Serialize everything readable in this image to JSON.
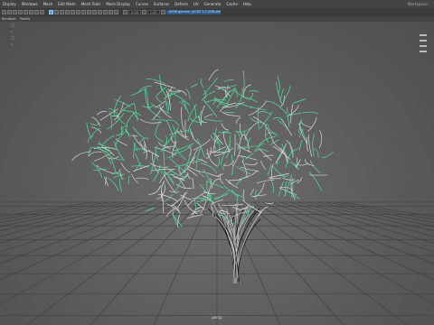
{
  "menubar": {
    "items": [
      "Display",
      "Windows",
      "Mesh",
      "Edit Mesh",
      "Mesh Tools",
      "Mesh Display",
      "Curves",
      "Surfaces",
      "Deform",
      "UV",
      "Generate",
      "Cache",
      "Help"
    ],
    "workspace": "Workspace:"
  },
  "toolbar": {
    "value1": "0.00",
    "value2": "1.00",
    "color_space": "sRGB gamma (ACES 1.0 SDR-video)"
  },
  "panel_menu": [
    "Renderer",
    "Panels"
  ],
  "left_icons": [
    "□",
    "▹",
    "□",
    "▹"
  ],
  "viewport": {
    "camera_label": "persp",
    "hair_color": "#54e0a0",
    "grid_color": "#3f3f3f"
  }
}
